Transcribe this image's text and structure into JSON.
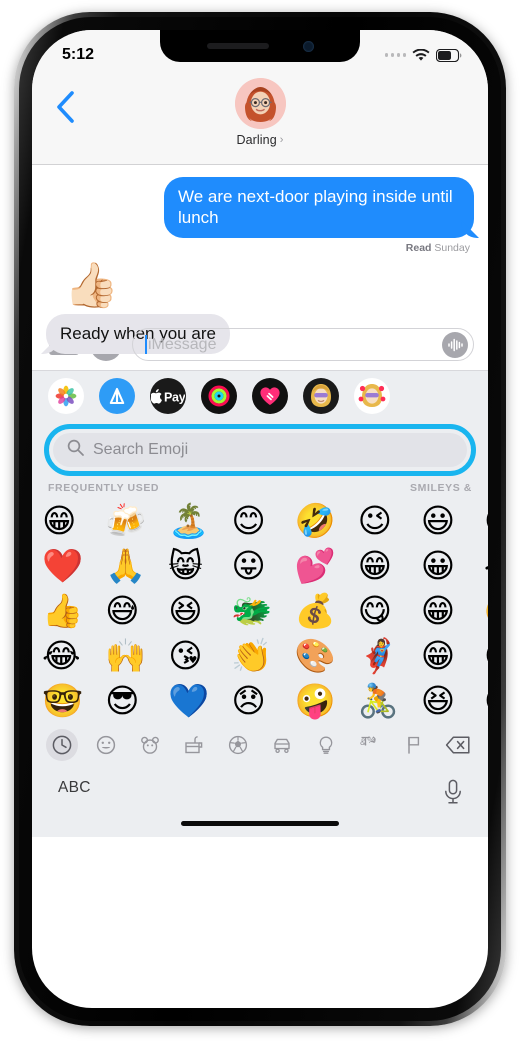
{
  "statusbar": {
    "time": "5:12",
    "signal_icon": "signal-dots-icon",
    "wifi_icon": "wifi-icon",
    "battery_icon": "battery-icon",
    "battery_level": 60
  },
  "navbar": {
    "back_icon": "back-chevron-icon",
    "contact_name": "Darling",
    "contact_chevron": "›",
    "avatar_icon": "memoji-avatar"
  },
  "conversation": {
    "messages": [
      {
        "direction": "outgoing",
        "text": "We are next-door playing inside until lunch"
      }
    ],
    "receipt_label": "Read",
    "receipt_time": "Sunday",
    "tapback_emoji": "👍🏻",
    "incoming_text": "Ready when you are"
  },
  "inputbar": {
    "camera_icon": "camera-icon",
    "appstore_icon": "app-store-icon",
    "placeholder": "iMessage",
    "audio_icon": "audio-waveform-icon"
  },
  "appdrawer": {
    "items": [
      {
        "name": "photos-app-icon",
        "glyph": "✿"
      },
      {
        "name": "app-store-app-icon",
        "glyph": "A"
      },
      {
        "name": "apple-pay-app-icon",
        "glyph": "Pay"
      },
      {
        "name": "fitness-app-icon",
        "glyph": "◎"
      },
      {
        "name": "digital-touch-app-icon",
        "glyph": "❤"
      },
      {
        "name": "memoji-app-icon",
        "glyph": "👱‍♀️"
      },
      {
        "name": "memoji-sticker-app-icon",
        "glyph": "🥰"
      }
    ]
  },
  "search": {
    "icon": "search-icon",
    "placeholder": "Search Emoji",
    "highlight_color": "#19b5ef"
  },
  "emoji_panel": {
    "section_left": "FREQUENTLY USED",
    "section_right": "SMILEYS &",
    "rows": [
      [
        "😁",
        "🍻",
        "🏝️",
        "😊",
        "🤣",
        "😉",
        "😃",
        "😅"
      ],
      [
        "❤️",
        "🙏",
        "😸",
        "😛",
        "💕",
        "😁",
        "😀",
        "😂"
      ],
      [
        "👍",
        "😅",
        "😆",
        "🐲",
        "💰",
        "😋",
        "😁",
        "🤣"
      ],
      [
        "😂",
        "🙌",
        "😘",
        "👏",
        "🎨",
        "🦸‍♀️",
        "😁",
        "😌"
      ],
      [
        "🤓",
        "😎",
        "💙",
        "😞",
        "🤪",
        "🚴",
        "😆",
        "😊"
      ]
    ]
  },
  "category_bar": {
    "items": [
      {
        "name": "category-recent",
        "icon": "clock-icon",
        "active": true
      },
      {
        "name": "category-smileys",
        "icon": "smiley-icon",
        "active": false
      },
      {
        "name": "category-animals",
        "icon": "bear-icon",
        "active": false
      },
      {
        "name": "category-food",
        "icon": "food-icon",
        "active": false
      },
      {
        "name": "category-activity",
        "icon": "soccer-ball-icon",
        "active": false
      },
      {
        "name": "category-travel",
        "icon": "car-icon",
        "active": false
      },
      {
        "name": "category-objects",
        "icon": "lightbulb-icon",
        "active": false
      },
      {
        "name": "category-symbols",
        "icon": "symbols-icon",
        "active": false
      },
      {
        "name": "category-flags",
        "icon": "flag-icon",
        "active": false
      },
      {
        "name": "delete-key",
        "icon": "backspace-icon",
        "active": false
      }
    ]
  },
  "keyboard_bottom": {
    "abc_label": "ABC",
    "mic_icon": "microphone-icon"
  }
}
